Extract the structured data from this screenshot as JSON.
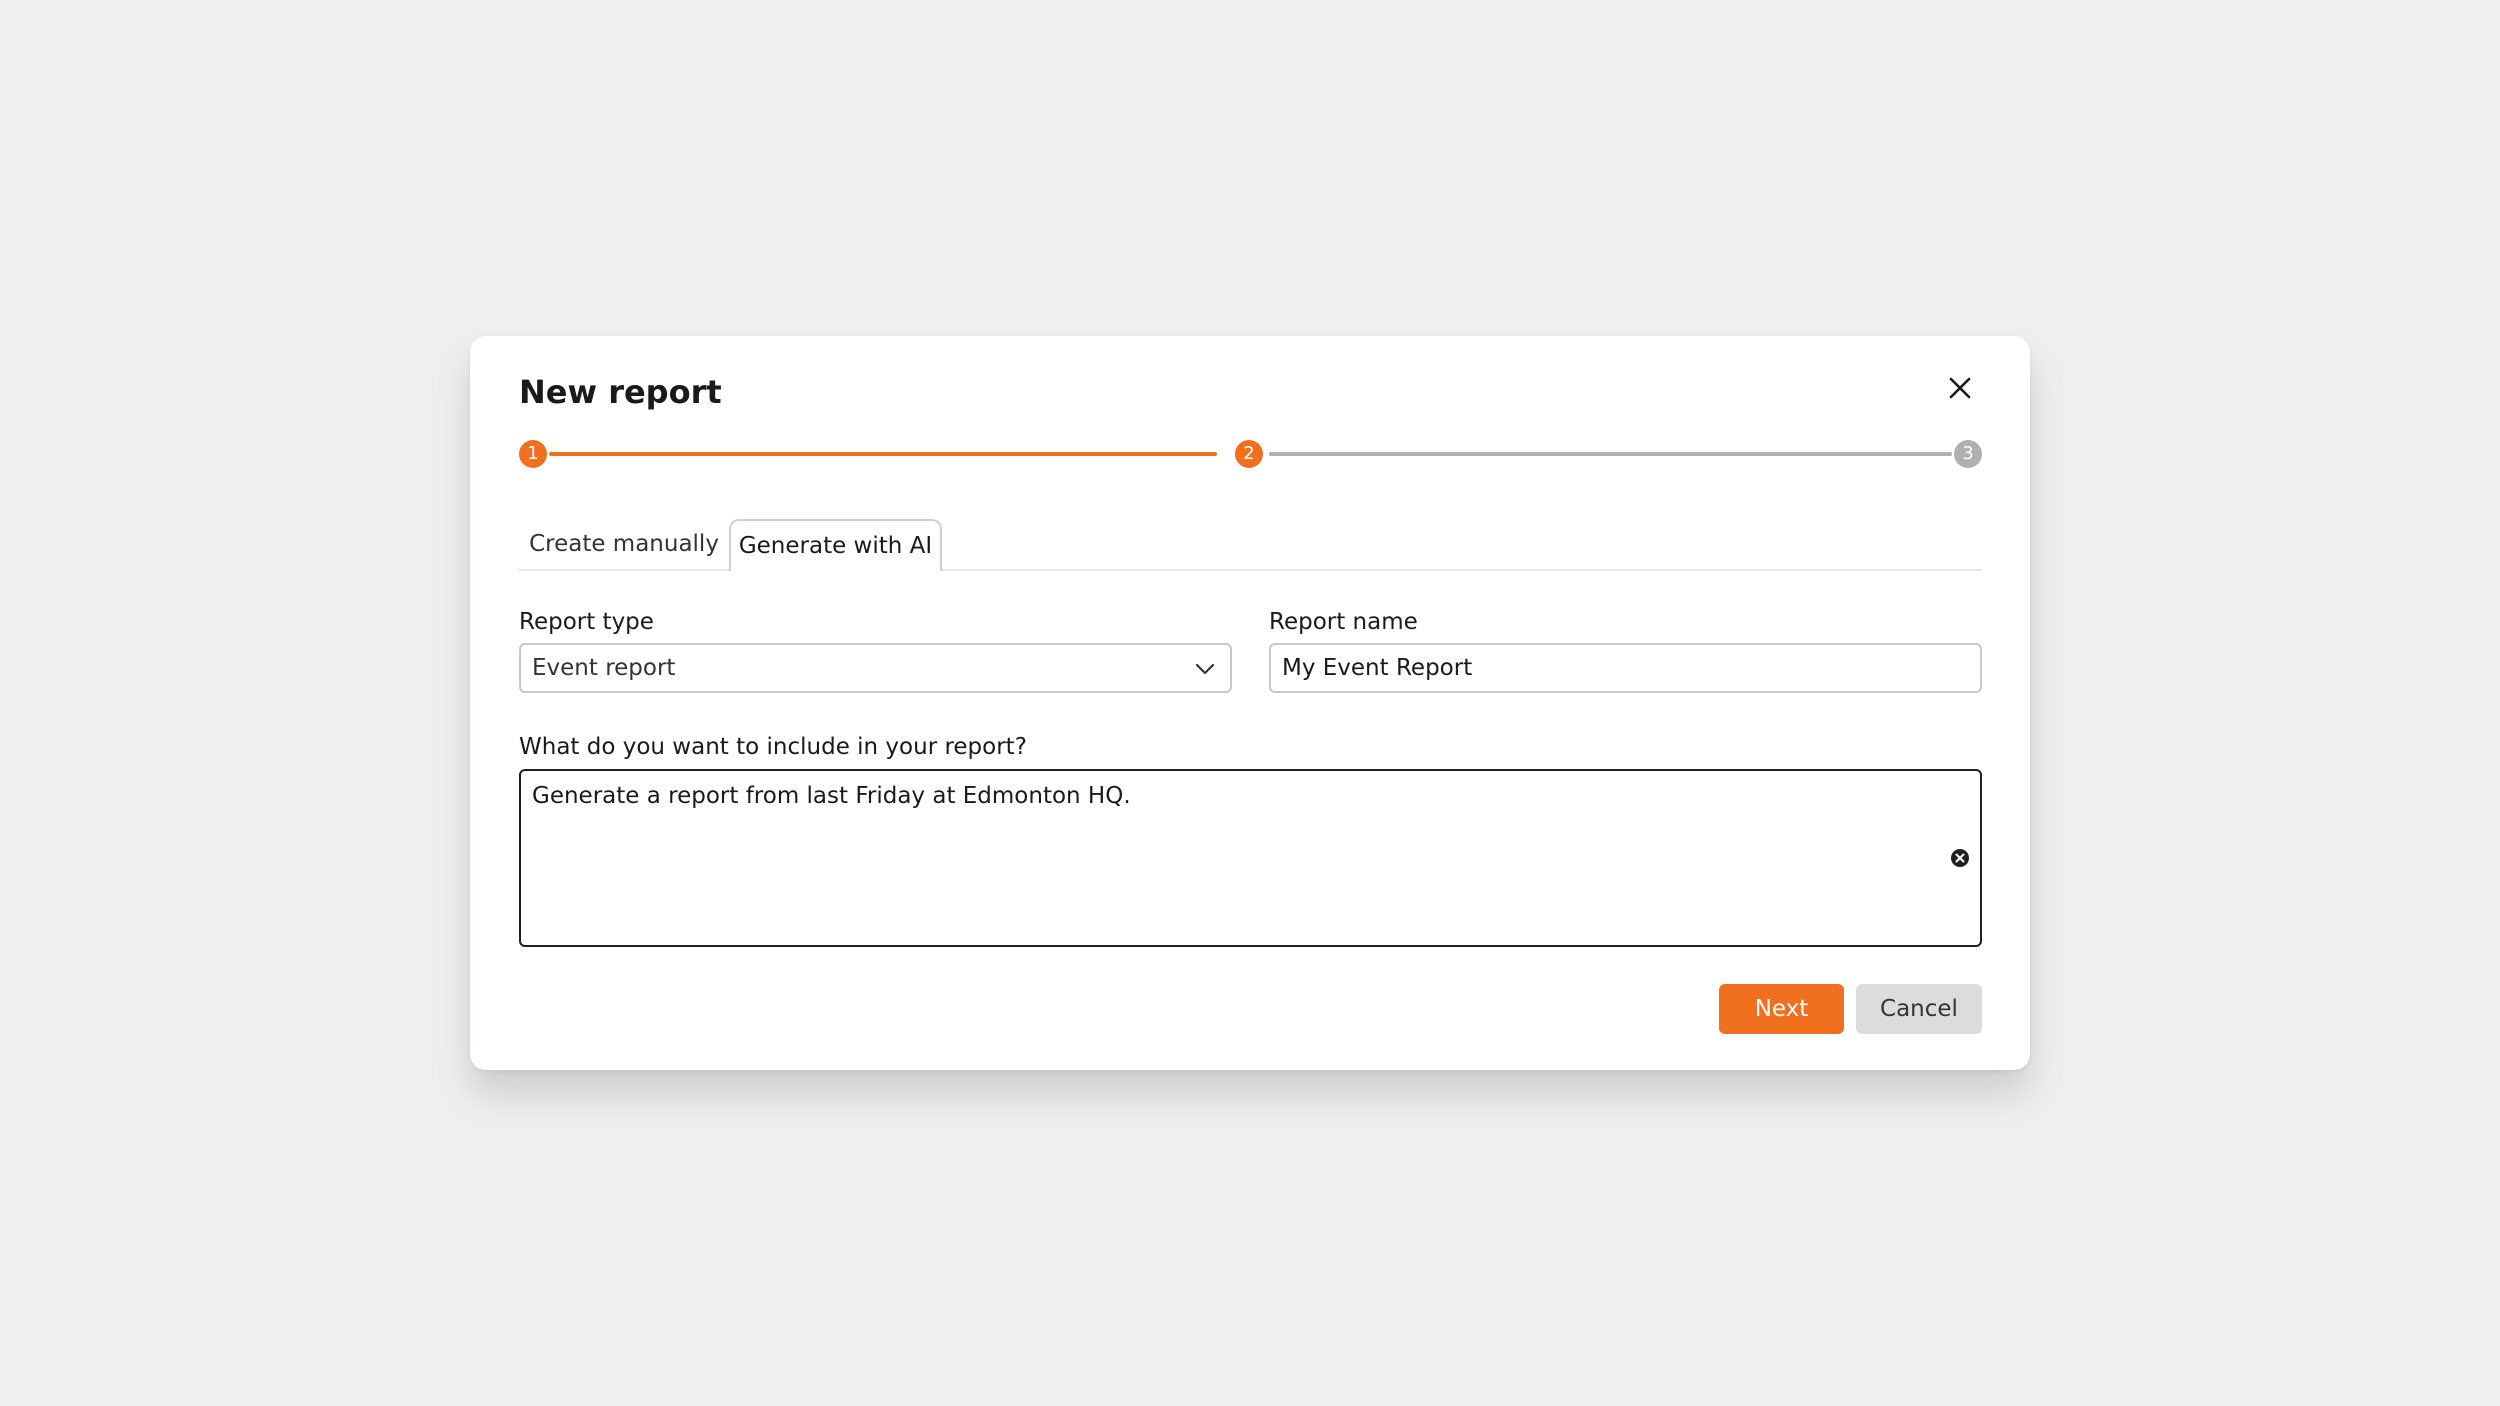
{
  "dialog": {
    "title": "New report",
    "close_icon": "close-icon"
  },
  "stepper": {
    "steps": [
      {
        "number": "1",
        "state": "complete"
      },
      {
        "number": "2",
        "state": "current"
      },
      {
        "number": "3",
        "state": "upcoming"
      }
    ],
    "active_color": "#f07020",
    "inactive_color": "#b0b0b0"
  },
  "tabs": [
    {
      "label": "Create manually",
      "selected": false
    },
    {
      "label": "Generate with AI",
      "selected": true
    }
  ],
  "form": {
    "report_type": {
      "label": "Report type",
      "value": "Event report",
      "icon": "chevron-down-icon"
    },
    "report_name": {
      "label": "Report name",
      "value": "My Event Report"
    },
    "prompt": {
      "label": "What do you want to include in your report?",
      "value": "Generate a report from last Friday at Edmonton HQ.",
      "clear_icon": "clear-circle-icon"
    }
  },
  "buttons": {
    "next_label": "Next",
    "cancel_label": "Cancel"
  },
  "colors": {
    "accent": "#f07020",
    "background": "#eeeff1",
    "dialog": "#ffffff"
  }
}
